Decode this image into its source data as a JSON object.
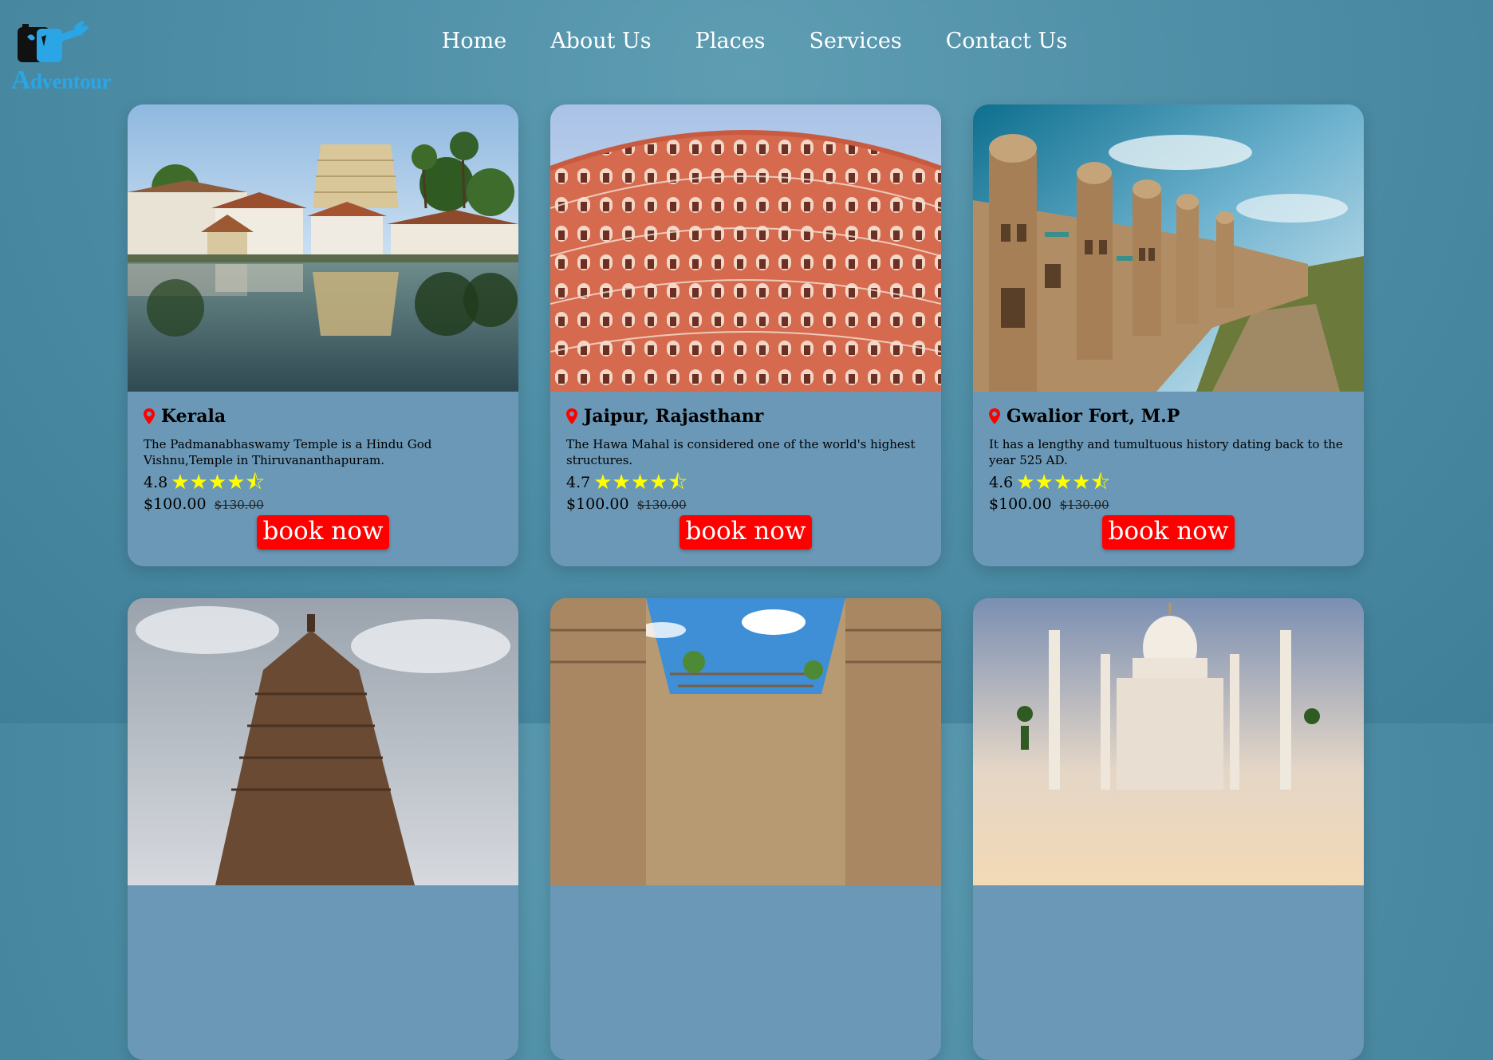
{
  "brand": {
    "logo_text_initial": "A",
    "logo_text_rest": "dventour"
  },
  "nav": [
    "Home",
    "About Us",
    "Places",
    "Services",
    "Contact Us"
  ],
  "colors": {
    "accent": "#ff0000",
    "card_bg": "#6a98b6",
    "star": "#ffff00",
    "brand_blue": "#2aa6e6"
  },
  "cards": [
    {
      "place": "Kerala",
      "description": "The Padmanabhaswamy Temple is a Hindu God Vishnu,Temple in Thiruvananthapuram.",
      "rating": "4.8",
      "price": "$100.00",
      "old_price": "$130.00",
      "button": "book now"
    },
    {
      "place": "Jaipur, Rajasthanr",
      "description": "The Hawa Mahal is considered one of the world's highest structures.",
      "rating": "4.7",
      "price": "$100.00",
      "old_price": "$130.00",
      "button": "book now"
    },
    {
      "place": "Gwalior Fort, M.P",
      "description": "It has a lengthy and tumultuous history dating back to the year 525 AD.",
      "rating": "4.6",
      "price": "$100.00",
      "old_price": "$130.00",
      "button": "book now"
    }
  ],
  "icons": {
    "location": "map-pin-icon",
    "star": "star-icon",
    "half_star": "half-star-icon"
  },
  "star_text": "★★★★⯪"
}
